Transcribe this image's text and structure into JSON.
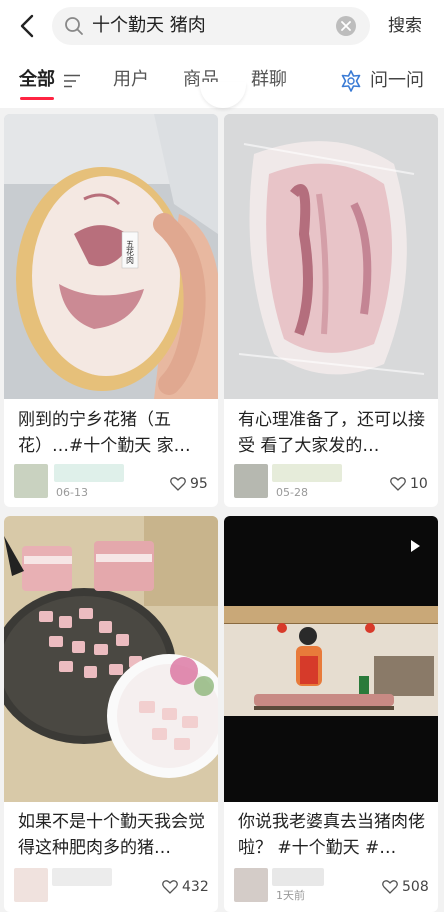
{
  "header": {
    "search_query": "十个勤天 猪肉",
    "search_button": "搜索"
  },
  "tabs": [
    {
      "label": "全部",
      "active": true
    },
    {
      "label": "用户"
    },
    {
      "label": "商品"
    },
    {
      "label": "群聊"
    }
  ],
  "ask_label": "问一问",
  "colors": {
    "accent": "#ff2442",
    "ask_icon": "#3a7bd5"
  },
  "posts": [
    {
      "title": "刚到的宁乡花猪（五花）…#十个勤天 家…",
      "date": "06-13",
      "likes": "95",
      "thumb_label": "五花肉"
    },
    {
      "title": "有心理准备了，还可以接受 看了大家发的…",
      "date": "05-28",
      "likes": "10"
    },
    {
      "title": "如果不是十个勤天我会觉得这种肥肉多的猪…",
      "date": "",
      "likes": "432"
    },
    {
      "title": "你说我老婆真去当猪肉佬啦？ #十个勤天 #…",
      "date": "1天前",
      "likes": "508",
      "is_video": true
    }
  ]
}
